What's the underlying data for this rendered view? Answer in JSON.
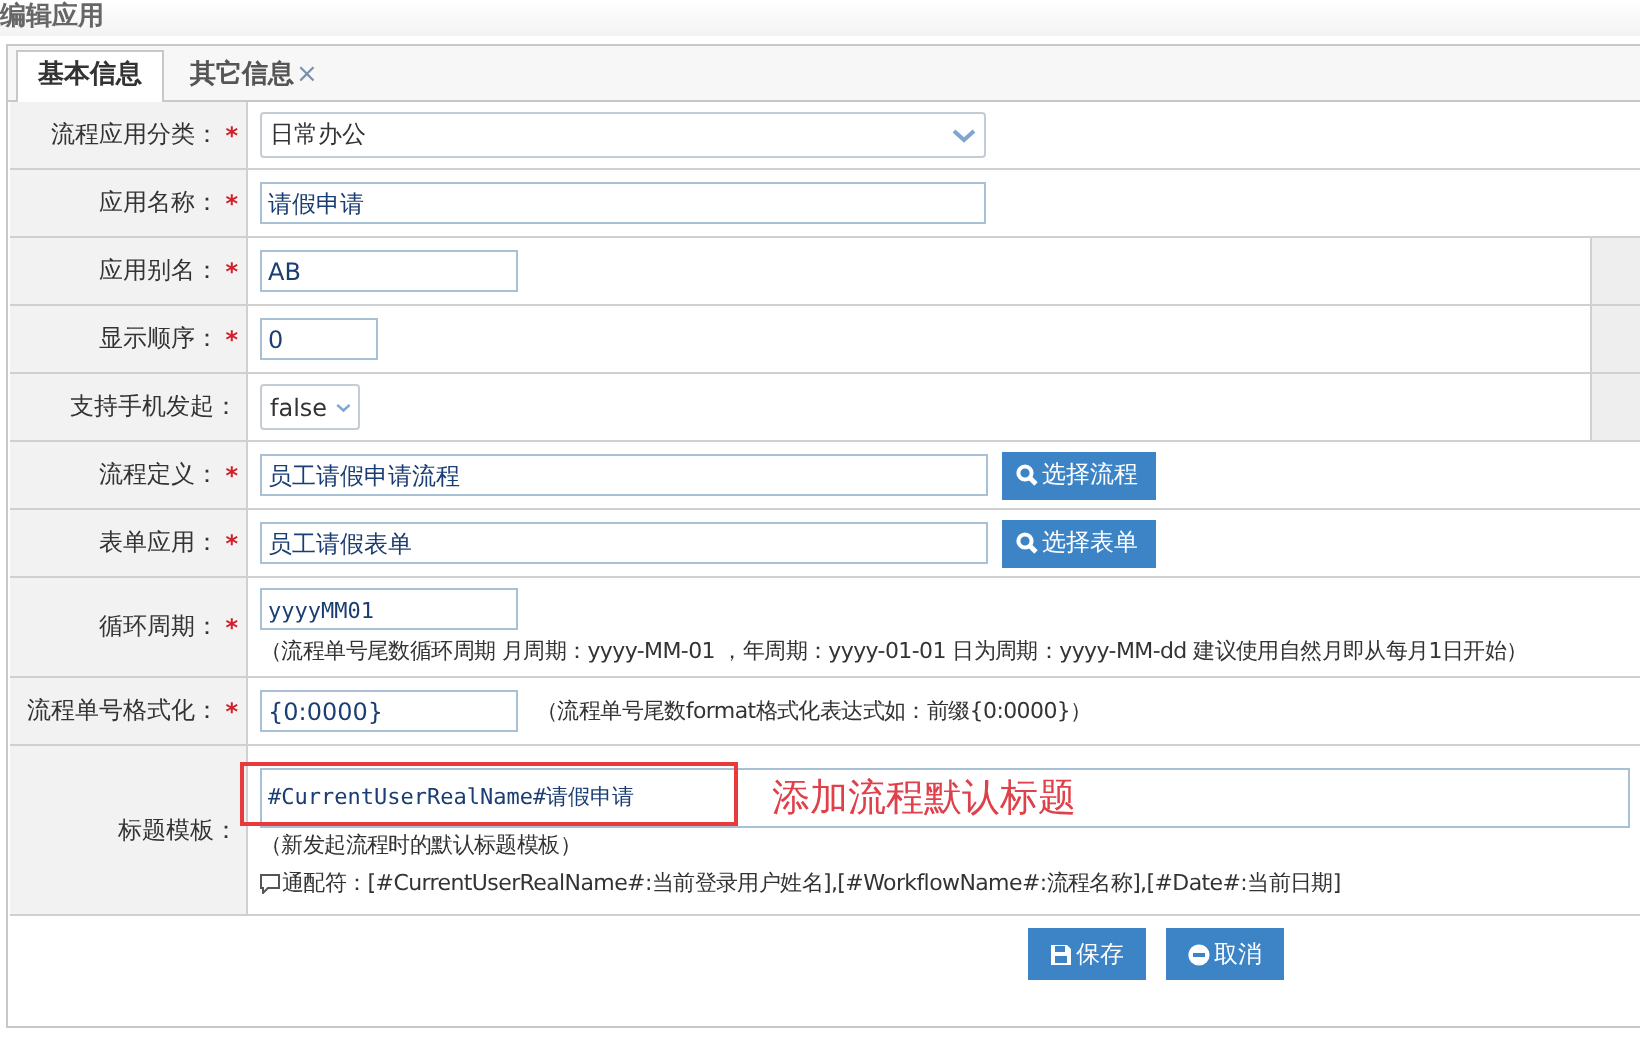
{
  "page_title": "编辑应用",
  "required_glyph": "*",
  "tabs": [
    {
      "label": "基本信息",
      "selected": true,
      "closable": false
    },
    {
      "label": "其它信息",
      "selected": false,
      "closable": true,
      "close_glyph": "×"
    }
  ],
  "rows": [
    {
      "label": "流程应用分类：",
      "required": true,
      "kind": "select",
      "value": "日常办公",
      "side_cell": false
    },
    {
      "label": "应用名称：",
      "required": true,
      "kind": "input",
      "value": "请假申请",
      "side_cell": false
    },
    {
      "label": "应用别名：",
      "required": true,
      "kind": "input",
      "value": "AB",
      "side_cell": true
    },
    {
      "label": "显示顺序：",
      "required": true,
      "kind": "input",
      "value": "0",
      "side_cell": true
    },
    {
      "label": "支持手机发起：",
      "required": false,
      "kind": "select",
      "value": "false",
      "side_cell": true
    },
    {
      "label": "流程定义：",
      "required": true,
      "kind": "input-button",
      "value": "员工请假申请流程",
      "button": "选择流程",
      "side_cell": false
    },
    {
      "label": "表单应用：",
      "required": true,
      "kind": "input-button",
      "value": "员工请假表单",
      "button": "选择表单",
      "side_cell": false
    },
    {
      "label": "循环周期：",
      "required": true,
      "kind": "input-hint-below",
      "value": "yyyyMM01",
      "hints": [
        "（流程单号尾数循环周期 月周期：yyyy-MM-01 ，年周期：yyyy-01-01 日为周期：yyyy-MM-dd 建议使用自然月即从每月1日开始）"
      ],
      "side_cell": false
    },
    {
      "label": "流程单号格式化：",
      "required": true,
      "kind": "input-hint-inline",
      "value": "{0:0000}",
      "hints": [
        "（流程单号尾数format格式化表达式如：前缀{0:0000}）"
      ],
      "side_cell": false
    },
    {
      "label": "标题模板：",
      "required": false,
      "kind": "template",
      "value": "#CurrentUserRealName#请假申请",
      "hints": [
        "（新发起流程时的默认标题模板）",
        "通配符：[#CurrentUserRealName#:当前登录用户姓名],[#WorkflowName#:流程名称],[#Date#:当前日期]"
      ],
      "annotation": "添加流程默认标题",
      "side_cell": false
    }
  ],
  "actions": [
    {
      "kind": "save",
      "label": "保存"
    },
    {
      "kind": "cancel",
      "label": "取消"
    }
  ]
}
